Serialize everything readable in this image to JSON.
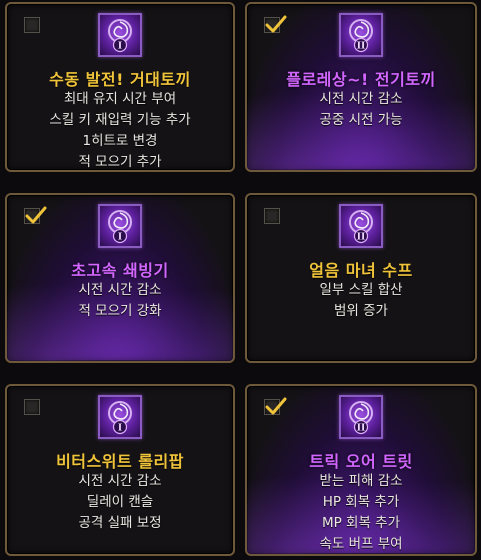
{
  "cards": [
    {
      "title": "수동 발전! 거대토끼",
      "tier": "I",
      "checked": false,
      "lines": [
        "최대 유지 시간 부여",
        "스킬 키 재입력 기능 추가",
        "1히트로 변경",
        "적 모으기 추가"
      ]
    },
    {
      "title": "플로레상~! 전기토끼",
      "tier": "II",
      "checked": true,
      "lines": [
        "시전 시간 감소",
        "공중 시전 가능"
      ]
    },
    {
      "title": "초고속 쇄빙기",
      "tier": "I",
      "checked": true,
      "lines": [
        "시전 시간 감소",
        "적 모으기 강화"
      ]
    },
    {
      "title": "얼음 마녀 수프",
      "tier": "II",
      "checked": false,
      "lines": [
        "일부 스킬 합산",
        "범위 증가"
      ]
    },
    {
      "title": "비터스위트 롤리팝",
      "tier": "I",
      "checked": false,
      "lines": [
        "시전 시간 감소",
        "딜레이 캔슬",
        "공격 실패 보정"
      ]
    },
    {
      "title": "트릭 오어 트릿",
      "tier": "II",
      "checked": true,
      "lines": [
        "받는 피해 감소",
        "HP 회복 추가",
        "MP 회복 추가",
        "속도 버프 부여"
      ]
    }
  ],
  "icons": [
    "tripod-skill-icon-rabbit-1",
    "tripod-skill-icon-rabbit-2",
    "tripod-skill-icon-icebreaker-1",
    "tripod-skill-icon-witch-soup-2",
    "tripod-skill-icon-lollipop-1",
    "tripod-skill-icon-trick-or-treat-2"
  ],
  "colors": {
    "title_selected": "#d266ff",
    "title_unselected": "#f0c43a",
    "border": "#6e5a3a",
    "checkmark": "#f0c43a"
  }
}
